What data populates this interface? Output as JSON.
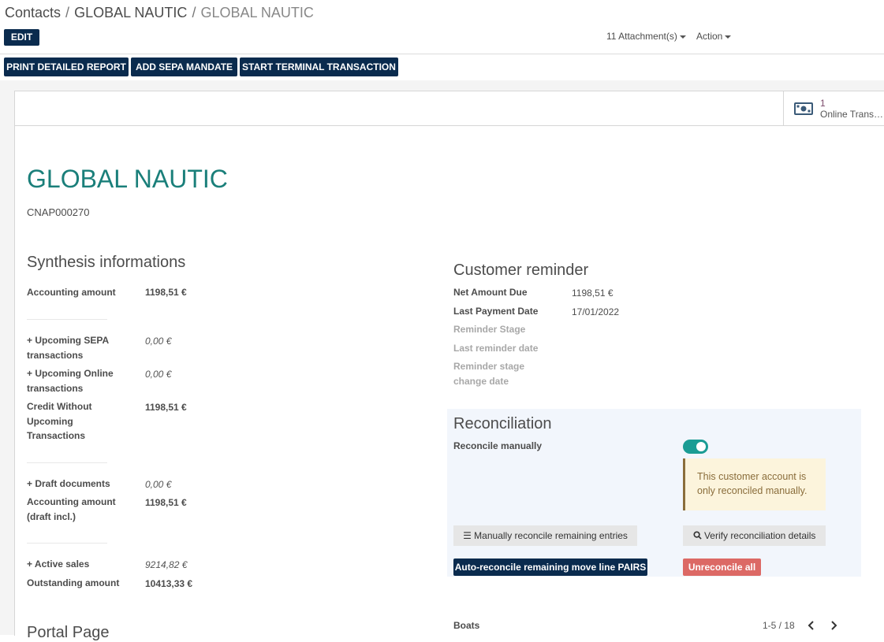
{
  "breadcrumb": {
    "items": [
      "Contacts",
      "GLOBAL NAUTIC"
    ],
    "current": "GLOBAL NAUTIC",
    "separator": "/"
  },
  "toolbar": {
    "edit_label": "EDIT",
    "attachments_label": "11 Attachment(s)",
    "action_label": "Action"
  },
  "header_buttons": {
    "print_report": "PRINT DETAILED REPORT",
    "add_sepa": "ADD SEPA MANDATE",
    "start_terminal": "START TERMINAL TRANSACTION"
  },
  "stat_button": {
    "value": "1",
    "label": "Online Transactions",
    "icon": "money-icon"
  },
  "record": {
    "name": "GLOBAL NAUTIC",
    "ref": "CNAP000270"
  },
  "synthesis": {
    "title": "Synthesis informations",
    "accounting_amount": {
      "label": "Accounting amount",
      "value": "1198,51 €"
    },
    "upcoming_sepa": {
      "label": "+ Upcoming SEPA transactions",
      "value": "0,00 €"
    },
    "upcoming_online": {
      "label": "+ Upcoming Online transactions",
      "value": "0,00 €"
    },
    "credit_without": {
      "label": "Credit Without Upcoming Transactions",
      "value": "1198,51 €"
    },
    "draft_docs": {
      "label": "+ Draft documents",
      "value": "0,00 €"
    },
    "accounting_draft": {
      "label": "Accounting amount (draft incl.)",
      "value": "1198,51 €"
    },
    "active_sales": {
      "label": "+ Active sales",
      "value": "9214,82 €"
    },
    "outstanding": {
      "label": "Outstanding amount",
      "value": "10413,33 €"
    }
  },
  "portal": {
    "title": "Portal Page"
  },
  "reminder": {
    "title": "Customer reminder",
    "net_amount_due": {
      "label": "Net Amount Due",
      "value": "1198,51 €"
    },
    "last_payment_date": {
      "label": "Last Payment Date",
      "value": "17/01/2022"
    },
    "reminder_stage": {
      "label": "Reminder Stage"
    },
    "last_reminder_date": {
      "label": "Last reminder date"
    },
    "reminder_stage_change": {
      "label": "Reminder stage change date"
    }
  },
  "reconciliation": {
    "title": "Reconciliation",
    "reconcile_manually_label": "Reconcile manually",
    "reconcile_manually": true,
    "alert": "This customer account is only reconciled manually.",
    "manual_btn": "Manually reconcile remaining entries",
    "verify_btn": "Verify reconciliation details",
    "auto_btn": "Auto-reconcile remaining move line PAIRS",
    "unreconcile_btn": "Unreconcile all"
  },
  "boats": {
    "label": "Boats",
    "pager": "1-5 / 18"
  },
  "colors": {
    "primary": "#0a2b4e",
    "title": "#1a7f7a",
    "toggle": "#1a9c94",
    "danger": "#dc6965"
  }
}
